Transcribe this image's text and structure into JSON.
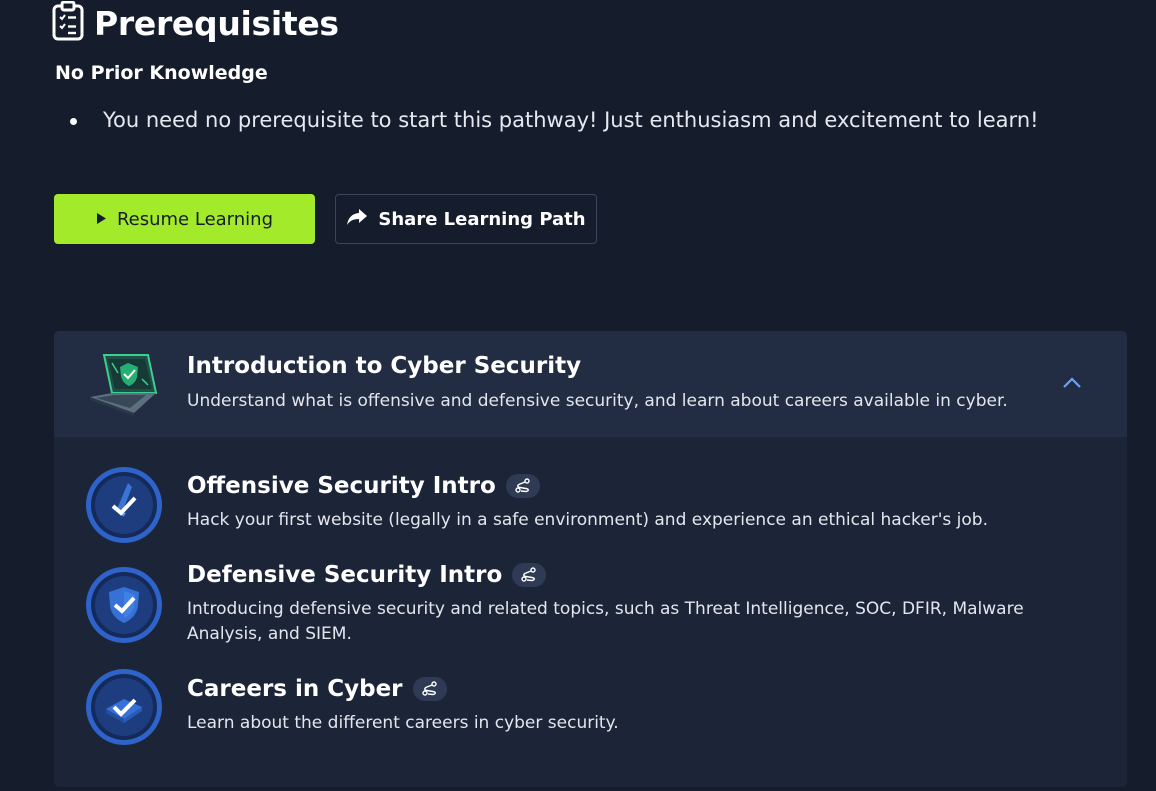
{
  "header": {
    "title": "Prerequisites",
    "icon": "clipboard-checklist-icon"
  },
  "prereq": {
    "subheading": "No Prior Knowledge",
    "bullets": [
      "You need no prerequisite to start this pathway! Just enthusiasm and excitement to learn!"
    ]
  },
  "actions": {
    "resume_label": "Resume Learning",
    "resume_icon": "play-icon",
    "share_label": "Share Learning Path",
    "share_icon": "share-arrow-icon"
  },
  "colors": {
    "background": "#151c2b",
    "accent": "#a3ea2a",
    "card": "#1c2538",
    "card_header": "#222c42",
    "badge_ring": "#4d86e8"
  },
  "module": {
    "title": "Introduction to Cyber Security",
    "description": "Understand what is offensive and defensive security, and learn about careers available in cyber.",
    "icon": "laptop-shield-icon",
    "expanded": true,
    "rooms": [
      {
        "title": "Offensive Security Intro",
        "description": "Hack your first website (legally in a safe environment) and experience an ethical hacker's job.",
        "completed": true,
        "badge_icon": "sword-badge-icon"
      },
      {
        "title": "Defensive Security Intro",
        "description": "Introducing defensive security and related topics, such as Threat Intelligence, SOC, DFIR, Malware Analysis, and SIEM.",
        "completed": true,
        "badge_icon": "shield-badge-icon"
      },
      {
        "title": "Careers in Cyber",
        "description": "Learn about the different careers in cyber security.",
        "completed": true,
        "badge_icon": "briefcase-badge-icon"
      }
    ]
  }
}
